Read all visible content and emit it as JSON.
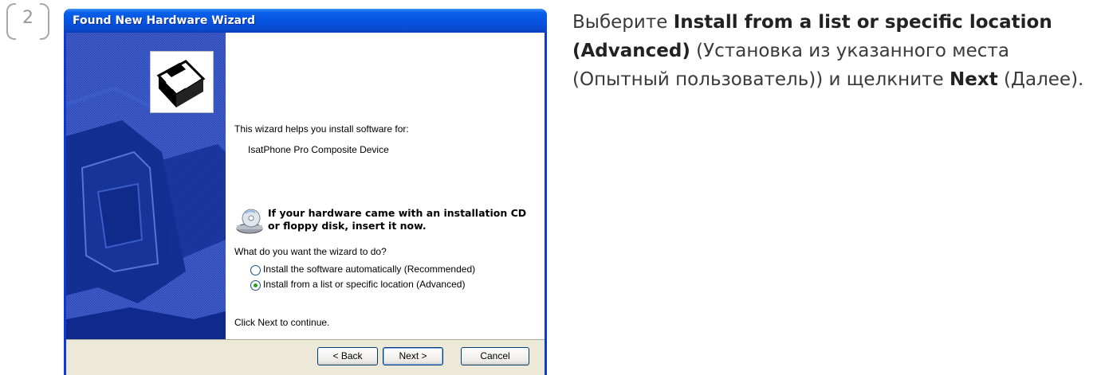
{
  "step": {
    "number": "2"
  },
  "window": {
    "title": "Found New Hardware Wizard",
    "intro": "This wizard helps you install software for:",
    "device": "IsatPhone Pro Composite Device",
    "cd_notice": "If your hardware came with an installation CD or floppy disk, insert it now.",
    "question": "What do you want the wizard to do?",
    "options": [
      {
        "label": "Install the software automatically (Recommended)",
        "selected": false
      },
      {
        "label": "Install from a list or specific location (Advanced)",
        "selected": true
      }
    ],
    "continue_text": "Click Next to continue.",
    "buttons": {
      "back": "< Back",
      "next": "Next >",
      "cancel": "Cancel"
    }
  },
  "instruction": {
    "prefix": "Выберите ",
    "option_bold": "Install from a list or specific location (Advanced)",
    "middle": " (Установка из указанного места (Опытный пользователь)) и щелкните ",
    "button_bold": "Next",
    "suffix": " (Далее)."
  },
  "colors": {
    "titlebar": "#0753e0",
    "left_panel": "#1d3ba6",
    "dialog_bg": "#ece9d8",
    "radio_dot": "#21a121"
  },
  "icons": [
    "hardware-card-icon",
    "cd-drive-icon"
  ]
}
